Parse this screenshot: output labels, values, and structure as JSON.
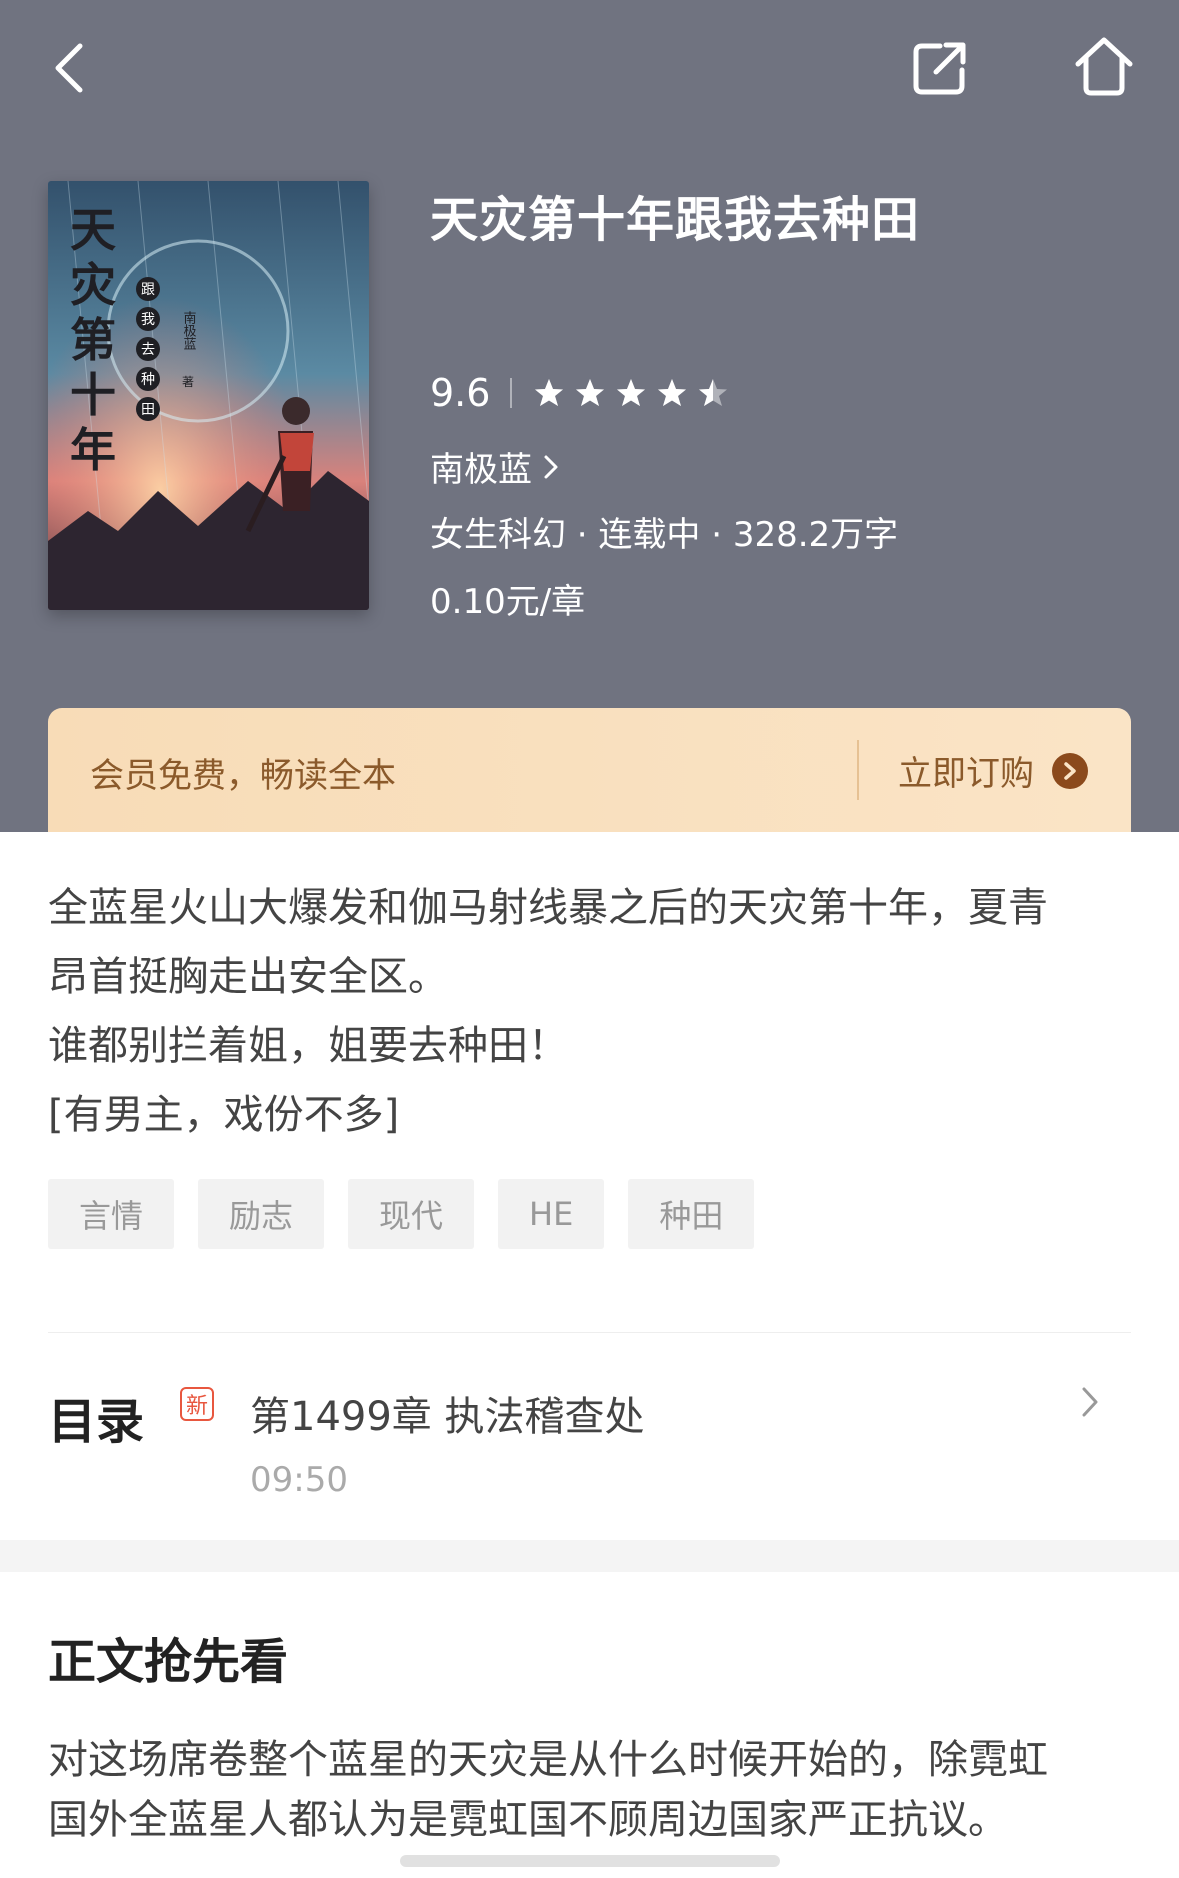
{
  "book": {
    "title": "天灾第十年跟我去种田",
    "rating": "9.6",
    "stars": 4.5,
    "author": "南极蓝",
    "meta": "女生科幻 · 连载中 · 328.2万字",
    "price": "0.10元/章",
    "cover": {
      "title_chars": [
        "天",
        "灾",
        "第",
        "十",
        "年"
      ],
      "subtitle_chars": [
        "跟",
        "我",
        "去",
        "种",
        "田"
      ],
      "author_vertical": "南极蓝",
      "author_suffix": "著"
    }
  },
  "vip_banner": {
    "text": "会员免费，畅读全本",
    "action": "立即订购"
  },
  "intro": {
    "lines": [
      "全蓝星火山大爆发和伽马射线暴之后的天灾第十年，夏青",
      "昂首挺胸走出安全区。",
      "谁都别拦着姐，姐要去种田！",
      "[有男主，戏份不多]"
    ]
  },
  "tags": [
    "言情",
    "励志",
    "现代",
    "HE",
    "种田"
  ],
  "toc": {
    "title": "目录",
    "new_badge": "新",
    "latest_chapter": "第1499章 执法稽查处",
    "update_time": "09:50"
  },
  "preview": {
    "title": "正文抢先看",
    "lines": [
      "对这场席卷整个蓝星的天灾是从什么时候开始的，除霓虹",
      "国外全蓝星人都认为是霓虹国不顾周边国家严正抗议。"
    ]
  },
  "icons": {
    "back": "chevron-left-icon",
    "share": "share-icon",
    "home": "home-icon",
    "author_chevron": "chevron-right-icon",
    "vip_arrow": "circle-arrow-right-icon",
    "toc_chevron": "chevron-right-icon"
  },
  "colors": {
    "header_bg": "#707380",
    "vip_bg": "#f8dcb7",
    "vip_text": "#8b5a2b",
    "new_badge": "#e8573f",
    "tag_bg": "#f2f2f2"
  }
}
